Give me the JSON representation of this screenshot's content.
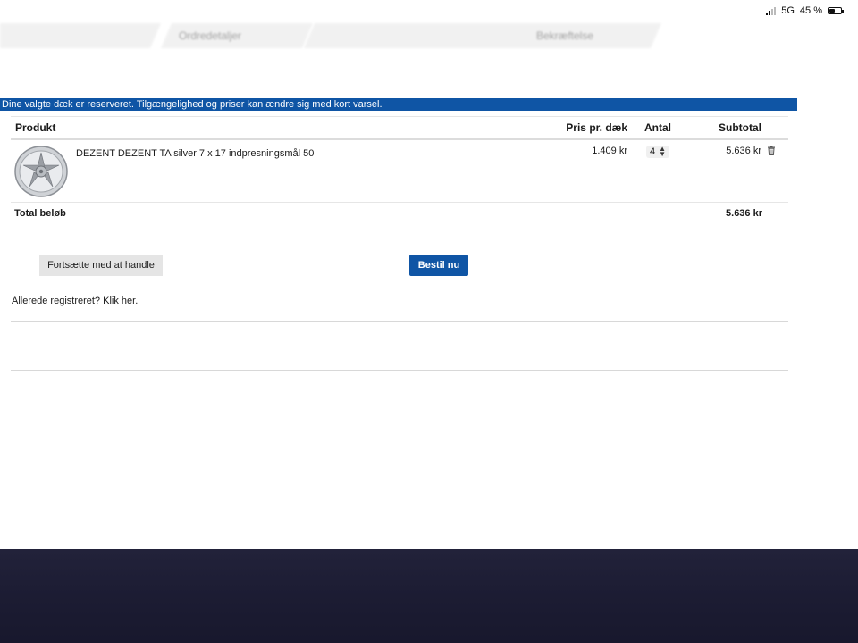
{
  "status_bar": {
    "network": "5G",
    "battery": "45 %"
  },
  "steps": [
    "Ordredetaljer",
    "Bekræftelse"
  ],
  "notice": "Dine valgte dæk er reserveret. Tilgængelighed og priser kan ændre sig med kort varsel.",
  "cart": {
    "columns": {
      "product": "Produkt",
      "price": "Pris pr. dæk",
      "qty": "Antal",
      "subtotal": "Subtotal"
    },
    "items": [
      {
        "name": "DEZENT DEZENT TA silver 7 x 17 indpresningsmål 50",
        "price": "1.409 kr",
        "qty": "4",
        "subtotal": "5.636 kr",
        "image": "alloy-wheel"
      }
    ],
    "total_label": "Total beløb",
    "total_value": "5.636 kr"
  },
  "buttons": {
    "continue": "Fortsætte med at handle",
    "order": "Bestil nu"
  },
  "login": {
    "text": "Allerede registreret?",
    "link": "Klik her."
  },
  "colors": {
    "accent": "#0f55a5",
    "bottom_band": "#1e1e36"
  }
}
